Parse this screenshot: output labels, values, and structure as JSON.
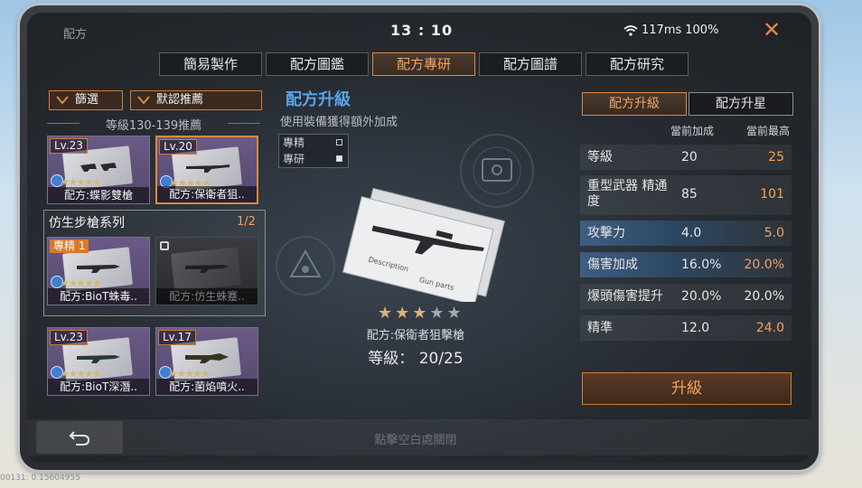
{
  "window": {
    "title": "配方",
    "time": "13 : 10",
    "ping": "117ms",
    "battery": "100%",
    "close_symbol": "✕"
  },
  "tabs": [
    {
      "label": "簡易製作",
      "active": false
    },
    {
      "label": "配方圖鑑",
      "active": false
    },
    {
      "label": "配方專研",
      "active": true
    },
    {
      "label": "配方圖譜",
      "active": false
    },
    {
      "label": "配方研究",
      "active": false
    }
  ],
  "left": {
    "filter_label": "篩選",
    "sort_label": "默認推薦",
    "section_title": "等級130-139推薦",
    "top_cards": [
      {
        "level": "Lv.23",
        "name": "配方:蝶影雙槍",
        "stars": "★★★★★",
        "selected": false
      },
      {
        "level": "Lv.20",
        "name": "配方:保衛者狙..",
        "stars": "★★★★★",
        "selected": true
      }
    ],
    "group": {
      "title": "仿生步槍系列",
      "count": "1/2",
      "cards": [
        {
          "badge": "專精 1",
          "name": "配方:BioT蛛毒..",
          "stars": "★★★★★",
          "locked": false
        },
        {
          "name": "配方:仿生蛛蹇..",
          "locked": true
        }
      ]
    },
    "bottom_cards": [
      {
        "level": "Lv.23",
        "name": "配方:BioT深潛..",
        "stars": "★★★★★"
      },
      {
        "level": "Lv.17",
        "name": "配方:菌焰噴火..",
        "stars": "★★★★★"
      }
    ]
  },
  "center": {
    "title": "配方升級",
    "subtitle": "使用裝備獲得額外加成",
    "legend": [
      {
        "label": "專精",
        "filled": false
      },
      {
        "label": "專研",
        "filled": true
      }
    ],
    "blueprint_texts": {
      "desc": "Description",
      "gun": "Gun parts"
    },
    "stars_on": "★★★",
    "stars_off": "★★",
    "item_name": "配方:保衛者狙擊槍",
    "level_text": "等級： 20/25"
  },
  "right": {
    "tabs": [
      {
        "label": "配方升級",
        "active": true
      },
      {
        "label": "配方升星",
        "active": false
      }
    ],
    "col_current": "當前加成",
    "col_max": "當前最高",
    "stats": [
      {
        "label": "等級",
        "current": "20",
        "max": "25",
        "highlight": false,
        "max_colored": true
      },
      {
        "label": "重型武器 精通度",
        "current": "85",
        "max": "101",
        "highlight": false,
        "max_colored": true
      },
      {
        "label": "攻擊力",
        "current": "4.0",
        "max": "5.0",
        "highlight": true,
        "max_colored": true
      },
      {
        "label": "傷害加成",
        "current": "16.0%",
        "max": "20.0%",
        "highlight": true,
        "max_colored": true
      },
      {
        "label": "爆頭傷害提升",
        "current": "20.0%",
        "max": "20.0%",
        "highlight": false,
        "max_colored": false
      },
      {
        "label": "精準",
        "current": "12.0",
        "max": "24.0",
        "highlight": false,
        "max_colored": true
      }
    ],
    "upgrade_label": "升級"
  },
  "bottom": {
    "close_hint": "點擊空白處關閉"
  },
  "footer": "00131: 0.15604955",
  "colors": {
    "accent": "#e1873f",
    "title_blue": "#5aa3e8",
    "highlight_blue": "#3e5e82"
  }
}
